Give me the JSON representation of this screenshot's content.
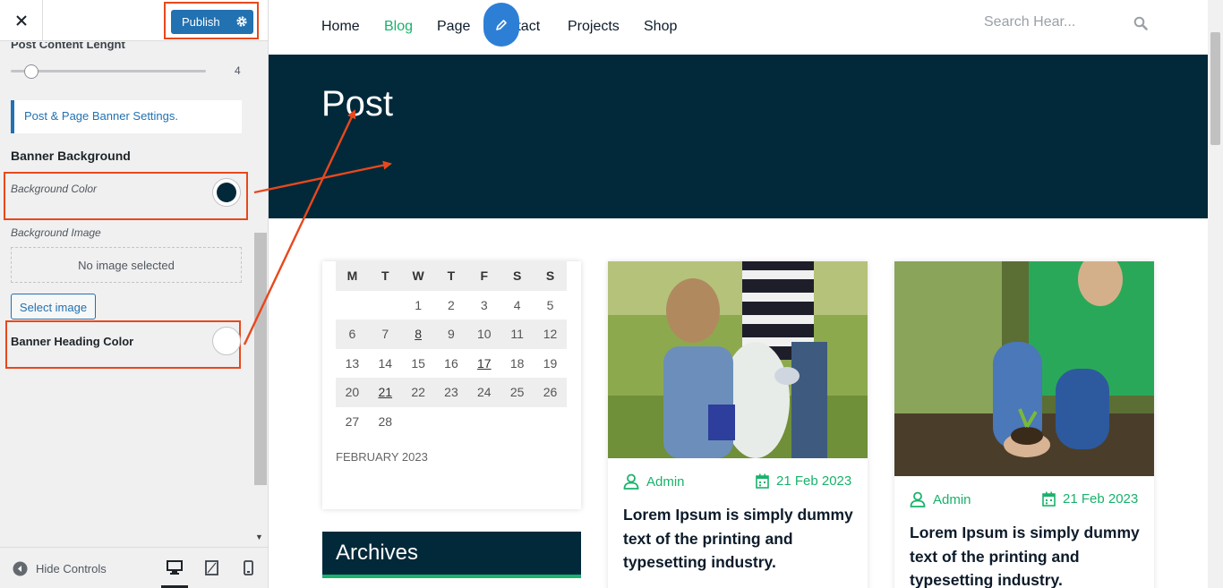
{
  "panel": {
    "close_icon": "close-icon",
    "publish_label": "Publish",
    "settings_icon": "gear-icon",
    "post_content_length_label": "Post Content Lenght",
    "slider_value": "4",
    "slider_fraction": 0.07,
    "section_title": "Post & Page Banner Settings.",
    "banner_background_label": "Banner Background",
    "background_color_label": "Background Color",
    "background_color_value": "#02293a",
    "background_image_label": "Background Image",
    "no_image_text": "No image selected",
    "select_image_label": "Select image",
    "banner_heading_color_label": "Banner Heading Color",
    "banner_heading_color_value": "#ffffff",
    "hide_controls_label": "Hide Controls",
    "devices": [
      "desktop-icon",
      "tablet-icon",
      "mobile-icon"
    ]
  },
  "site": {
    "nav": {
      "items": [
        {
          "label": "Home",
          "active": false
        },
        {
          "label": "Blog",
          "active": true
        },
        {
          "label": "Page",
          "active": false
        },
        {
          "label": "Contact",
          "active": false
        },
        {
          "label": "Projects",
          "active": false
        },
        {
          "label": "Shop",
          "active": false
        }
      ],
      "search_placeholder": "Search Hear..."
    },
    "banner_title": "Post",
    "calendar": {
      "days": [
        "M",
        "T",
        "W",
        "T",
        "F",
        "S",
        "S"
      ],
      "weeks": [
        [
          "",
          "",
          "1",
          "2",
          "3",
          "4",
          "5"
        ],
        [
          "6",
          "7",
          "8",
          "9",
          "10",
          "11",
          "12"
        ],
        [
          "13",
          "14",
          "15",
          "16",
          "17",
          "18",
          "19"
        ],
        [
          "20",
          "21",
          "22",
          "23",
          "24",
          "25",
          "26"
        ],
        [
          "27",
          "28",
          "",
          "",
          "",
          "",
          ""
        ]
      ],
      "linked_days": [
        "8",
        "17",
        "21"
      ],
      "caption": "FEBRUARY 2023"
    },
    "archives_title": "Archives",
    "posts": [
      {
        "author": "Admin",
        "date": "21 Feb 2023",
        "title": "Lorem Ipsum is simply dummy text of the printing and typesetting industry."
      },
      {
        "author": "Admin",
        "date": "21 Feb 2023",
        "title": "Lorem Ipsum is simply dummy text of the printing and typesetting industry."
      }
    ]
  },
  "colors": {
    "accent_green": "#19b26b",
    "banner_navy": "#02293a",
    "wp_blue": "#2271b1",
    "annotation_orange": "#e8481c"
  }
}
